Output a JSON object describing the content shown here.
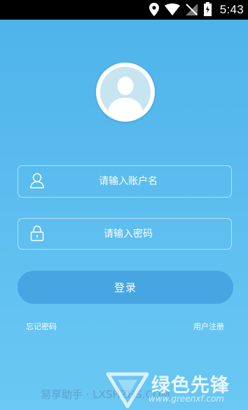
{
  "status_bar": {
    "time": "5:43",
    "icons": [
      "location-icon",
      "wifi-icon",
      "no-signal-icon",
      "battery-charging-icon"
    ]
  },
  "login": {
    "avatar_icon": "user-avatar-icon",
    "username": {
      "icon": "user-icon",
      "placeholder": "请输入账户名",
      "value": ""
    },
    "password": {
      "icon": "lock-icon",
      "placeholder": "请输入密码",
      "value": ""
    },
    "login_button": "登录",
    "forgot_password": "忘记密码",
    "register": "用户注册"
  },
  "watermark": {
    "left": "易享助手 · LXSHZHS.COM",
    "brand": "绿色先锋",
    "url": "www.greenxf.com"
  },
  "colors": {
    "background_top": "#4db3ea",
    "background_bottom": "#6ac8f3",
    "button": "#47a6e2",
    "avatar_fill": "#c7e4f1"
  }
}
